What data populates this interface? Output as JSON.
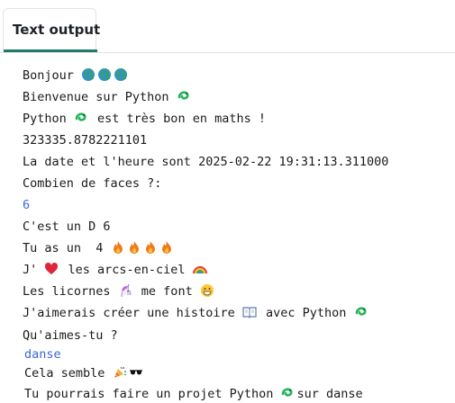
{
  "tab": {
    "label": "Text output"
  },
  "colors": {
    "accent": "#1f7a6b",
    "input_text": "#3a67d6"
  },
  "lines": [
    {
      "text": "Bonjour ",
      "icons": [
        "globe-icon",
        "globe-icon",
        "globe-icon"
      ],
      "after": ""
    },
    {
      "text": "Bienvenue sur Python ",
      "icons": [
        "python-icon"
      ],
      "after": ""
    },
    {
      "text": "Python ",
      "icons": [
        "python-icon"
      ],
      "after": " est très bon en maths !"
    },
    {
      "text": "323335.8782221101",
      "icons": [],
      "after": ""
    },
    {
      "text": "La date et l'heure sont 2025-02-22 19:31:13.311000",
      "icons": [],
      "after": ""
    },
    {
      "text": "Combien de faces ?:",
      "icons": [],
      "after": ""
    },
    {
      "text": "6",
      "icons": [],
      "after": "",
      "input": true
    },
    {
      "text": "C'est un D 6",
      "icons": [],
      "after": ""
    },
    {
      "text": "Tu as un  4 ",
      "icons": [
        "fire-icon",
        "fire-icon",
        "fire-icon",
        "fire-icon"
      ],
      "after": ""
    },
    {
      "text": "J' ",
      "icons": [
        "heart-icon"
      ],
      "after": " les arcs-en-ciel ",
      "icons_after": [
        "rainbow-icon"
      ]
    },
    {
      "text": "Les licornes ",
      "icons": [
        "unicorn-icon"
      ],
      "after": " me font ",
      "icons_after": [
        "grin-icon"
      ]
    },
    {
      "text": "J'aimerais créer une histoire ",
      "icons": [
        "book-icon"
      ],
      "after": " avec Python ",
      "icons_after": [
        "python-icon"
      ]
    },
    {
      "text": "Qu'aimes-tu ?",
      "icons": [],
      "after": ""
    },
    {
      "text": "danse",
      "icons": [],
      "after": "",
      "input": true
    },
    {
      "text": "Cela semble ",
      "icons": [
        "party-icon",
        "sunglasses-icon"
      ],
      "after": ""
    },
    {
      "text": "Tu pourrais faire un projet Python ",
      "icons": [
        "python-icon"
      ],
      "after": "sur danse"
    }
  ]
}
